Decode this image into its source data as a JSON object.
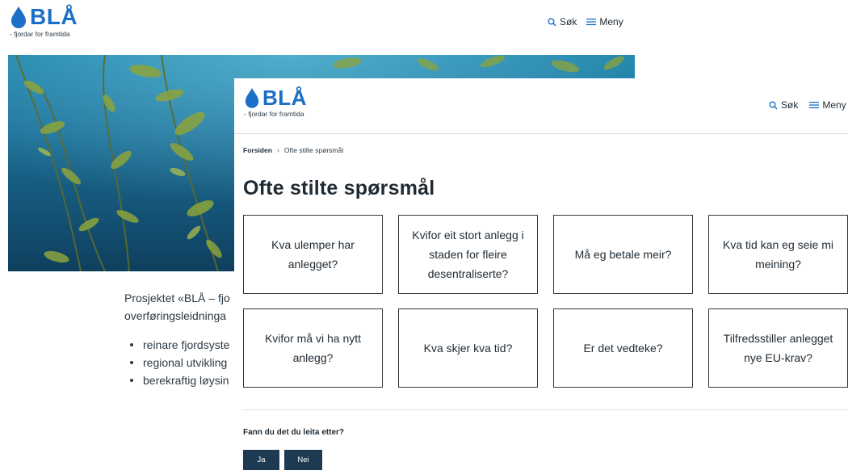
{
  "brand": {
    "name": "BLÅ",
    "tagline": "- fjordar for framtida",
    "accent": "#1b6fc6"
  },
  "nav": {
    "search_label": "Søk",
    "menu_label": "Meny",
    "search_icon": "search-icon",
    "menu_icon": "hamburger-menu-icon"
  },
  "background_page": {
    "hero_image": "kelp forest underwater photo",
    "intro_line1": "Prosjektet «BLÅ – fjo",
    "intro_line2": "overføringsleidninga",
    "bullets": [
      "reinare fjordsyste",
      "regional utvikling",
      "berekraftig løysin"
    ]
  },
  "overlay_page": {
    "breadcrumb": {
      "home": "Forsiden",
      "separator": "›",
      "current": "Ofte stilte spørsmål"
    },
    "title": "Ofte stilte spørsmål",
    "faq_cards": [
      "Kva ulemper har anlegget?",
      "Kvifor eit stort anlegg i staden for fleire desentraliserte?",
      "Må eg betale meir?",
      "Kva tid kan eg seie mi meining?",
      "Kvifor må vi ha nytt anlegg?",
      "Kva skjer kva tid?",
      "Er det vedteke?",
      "Tilfredsstiller anlegget nye EU-krav?"
    ],
    "feedback": {
      "question": "Fann du det du leita etter?",
      "yes_label": "Ja",
      "no_label": "Nei",
      "button_color": "#1d3a52"
    }
  }
}
